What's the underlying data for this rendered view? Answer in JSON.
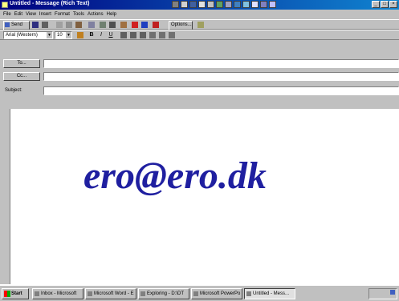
{
  "window": {
    "title": "Untitled - Message (Rich Text)",
    "buttons": [
      "_",
      "□",
      "×"
    ]
  },
  "menu": [
    "File",
    "Edit",
    "View",
    "Insert",
    "Format",
    "Tools",
    "Actions",
    "Help"
  ],
  "toolbar1": {
    "send_label": "Send",
    "options_label": "Options..."
  },
  "toolbar2": {
    "font": "Arial (Western)",
    "size": "10"
  },
  "fields": {
    "to_label": "To...",
    "cc_label": "Cc...",
    "subject_label": "Subject:"
  },
  "body": {
    "text": "ero@ero.dk"
  },
  "taskbar": {
    "start_label": "Start",
    "tasks": [
      "Inbox - Microsoft",
      "Microsoft Word - E",
      "Exploring - D:\\DT",
      "Microsoft PowerPo",
      "Untitled - Mess..."
    ]
  },
  "colors": {
    "title_bar": "#000080",
    "body_text": "#1f1fa0",
    "chrome": "#c0c0c0"
  }
}
